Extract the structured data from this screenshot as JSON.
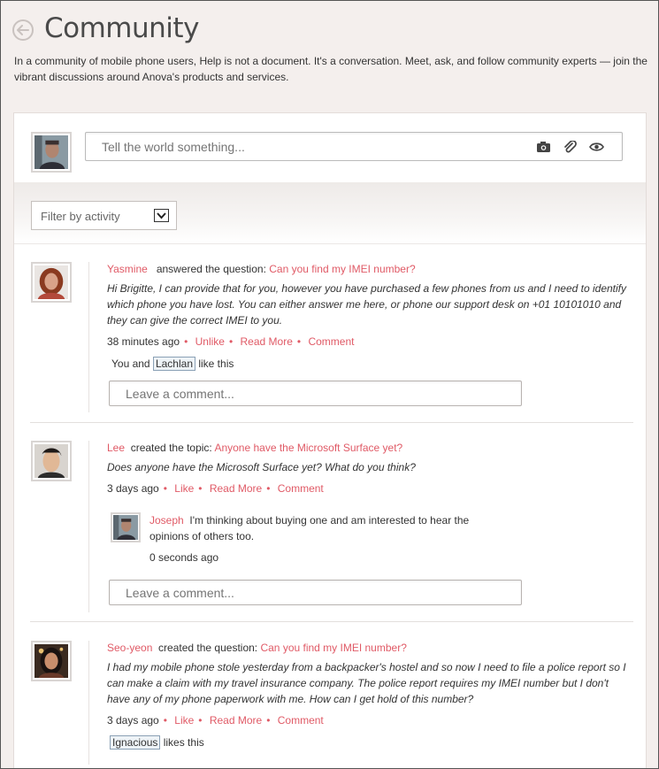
{
  "header": {
    "title": "Community",
    "intro": "In a community of mobile phone users, Help is not a document. It's a conversation. Meet, ask, and follow community experts — join the vibrant discussions around Anova's products and services."
  },
  "composer": {
    "placeholder": "Tell the world something...",
    "icons": [
      "camera-icon",
      "paperclip-icon",
      "eye-icon"
    ]
  },
  "filter": {
    "label": "Filter by activity"
  },
  "comment_placeholder": "Leave a comment...",
  "posts": [
    {
      "author": "Yasmine",
      "action": "answered the question:",
      "subject": "Can you find my IMEI number?",
      "body": "Hi Brigitte, I can provide that for you, however you have purchased a few phones from us and I need to identify which phone you have lost. You can either answer me here, or phone our support desk on +01 10101010 and they can give the correct IMEI to you.",
      "time": "38 minutes ago",
      "actions": [
        "Unlike",
        "Read More",
        "Comment"
      ],
      "likes_prefix": "You and",
      "likes_name": "Lachlan",
      "likes_suffix": "like this"
    },
    {
      "author": "Lee",
      "action": "created the topic:",
      "subject": "Anyone have the Microsoft Surface yet?",
      "body": "Does anyone have the Microsoft Surface yet? What do you think?",
      "time": "3 days ago",
      "actions": [
        "Like",
        "Read More",
        "Comment"
      ],
      "reply": {
        "author": "Joseph",
        "text": "I'm thinking about buying one and am interested to hear the opinions of others too.",
        "time": "0 seconds ago"
      }
    },
    {
      "author": "Seo-yeon",
      "action": "created the question:",
      "subject": "Can you find my IMEI number?",
      "body": "I had my mobile phone stole yesterday from a backpacker's hostel and so now I need to file a police report so I can make a claim with my travel insurance company. The police report requires my IMEI number but I don't have any of my phone paperwork with me. How can I get hold of this number?",
      "time": "3 days ago",
      "actions": [
        "Like",
        "Read More",
        "Comment"
      ],
      "likes_name": "Ignacious",
      "likes_suffix": "likes this"
    }
  ],
  "colors": {
    "accent": "#e05a66",
    "background": "#f4efed"
  }
}
